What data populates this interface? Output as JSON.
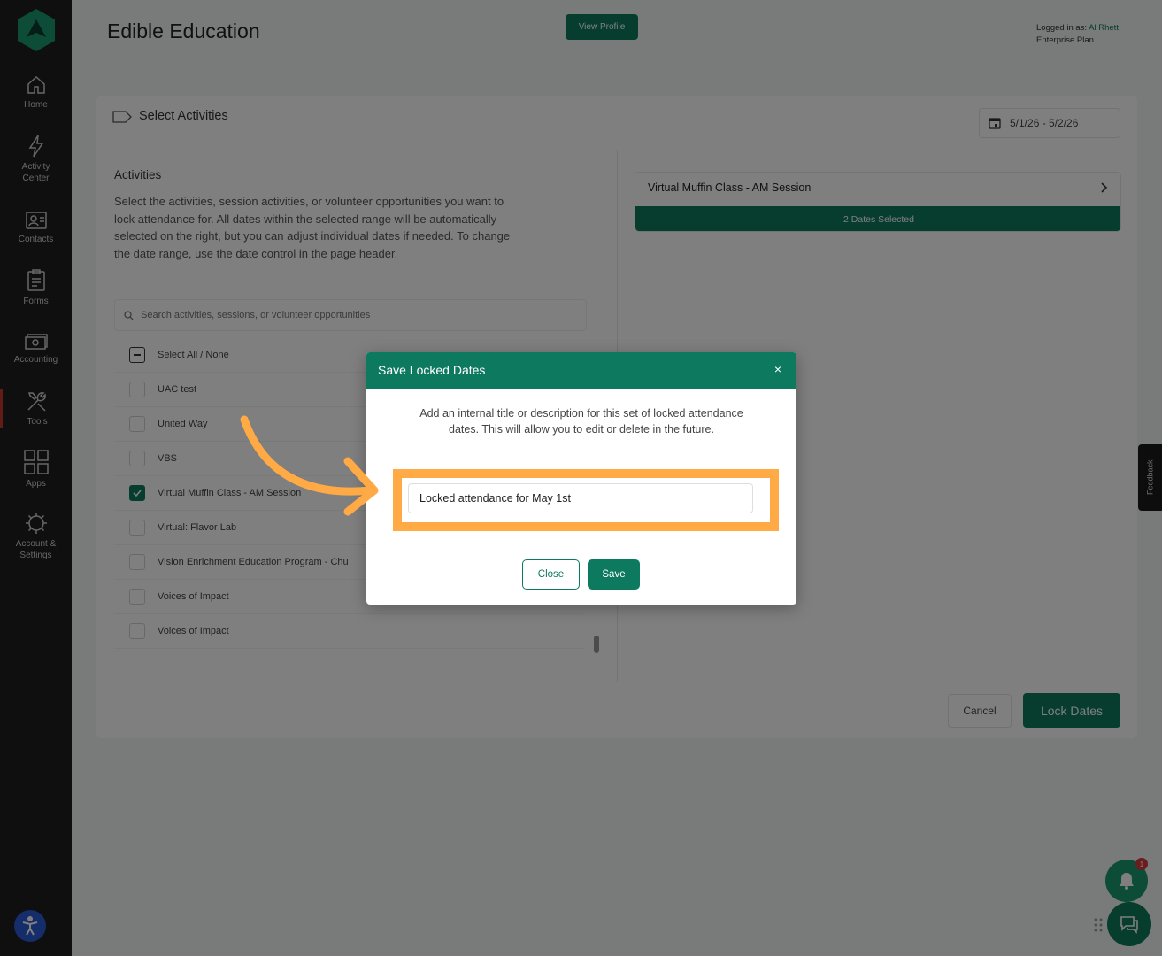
{
  "app": {
    "title": "Edible Education",
    "view_profile_label": "View Profile",
    "logged_in_prefix": "Logged in as: ",
    "logged_in_user": "Al Rhett",
    "plan": "Enterprise Plan",
    "accent_color": "#0d7a5f"
  },
  "sidebar": {
    "items": [
      {
        "label": "Home",
        "icon": "home-icon"
      },
      {
        "label": "Activity\nCenter",
        "icon": "lightning-icon"
      },
      {
        "label": "Contacts",
        "icon": "contacts-icon"
      },
      {
        "label": "Forms",
        "icon": "forms-icon"
      },
      {
        "label": "Accounting",
        "icon": "accounting-icon"
      },
      {
        "label": "Tools",
        "icon": "tools-icon"
      },
      {
        "label": "Apps",
        "icon": "apps-icon"
      },
      {
        "label": "Account &\nSettings",
        "icon": "settings-icon"
      }
    ]
  },
  "card": {
    "title": "Select Activities",
    "date_range": "5/1/26 - 5/2/26",
    "section_title": "Activities",
    "section_desc": "Select the activities, session activities, or volunteer opportunities you want to lock attendance for. All dates within the selected range will be automatically selected on the right, but you can adjust individual dates if needed. To change the date range, use the date control in the page header.",
    "search_placeholder": "Search activities, sessions, or volunteer opportunities",
    "select_all_label": "Select All / None",
    "activities": [
      {
        "label": "UAC test",
        "checked": false
      },
      {
        "label": "United Way",
        "checked": false
      },
      {
        "label": "VBS",
        "checked": false
      },
      {
        "label": "Virtual Muffin Class - AM Session",
        "checked": true
      },
      {
        "label": "Virtual: Flavor Lab",
        "checked": false
      },
      {
        "label": "Vision Enrichment Education Program - Chu",
        "checked": false
      },
      {
        "label": "Voices of Impact",
        "checked": false
      },
      {
        "label": "Voices of Impact",
        "checked": false
      }
    ],
    "selected_activity": "Virtual Muffin Class - AM Session",
    "dates_selected": "2 Dates Selected",
    "cancel_label": "Cancel",
    "lock_label": "Lock Dates"
  },
  "feedback_label": "Feedback",
  "notification_count": "1",
  "modal": {
    "title": "Save Locked Dates",
    "close_icon": "×",
    "description": "Add an internal title or description for this set of locked attendance dates. This will allow you to edit or delete in the future.",
    "input_value": "Locked attendance for May 1st",
    "close_label": "Close",
    "save_label": "Save"
  },
  "annotation": {
    "highlight_color": "#ffaa45"
  }
}
